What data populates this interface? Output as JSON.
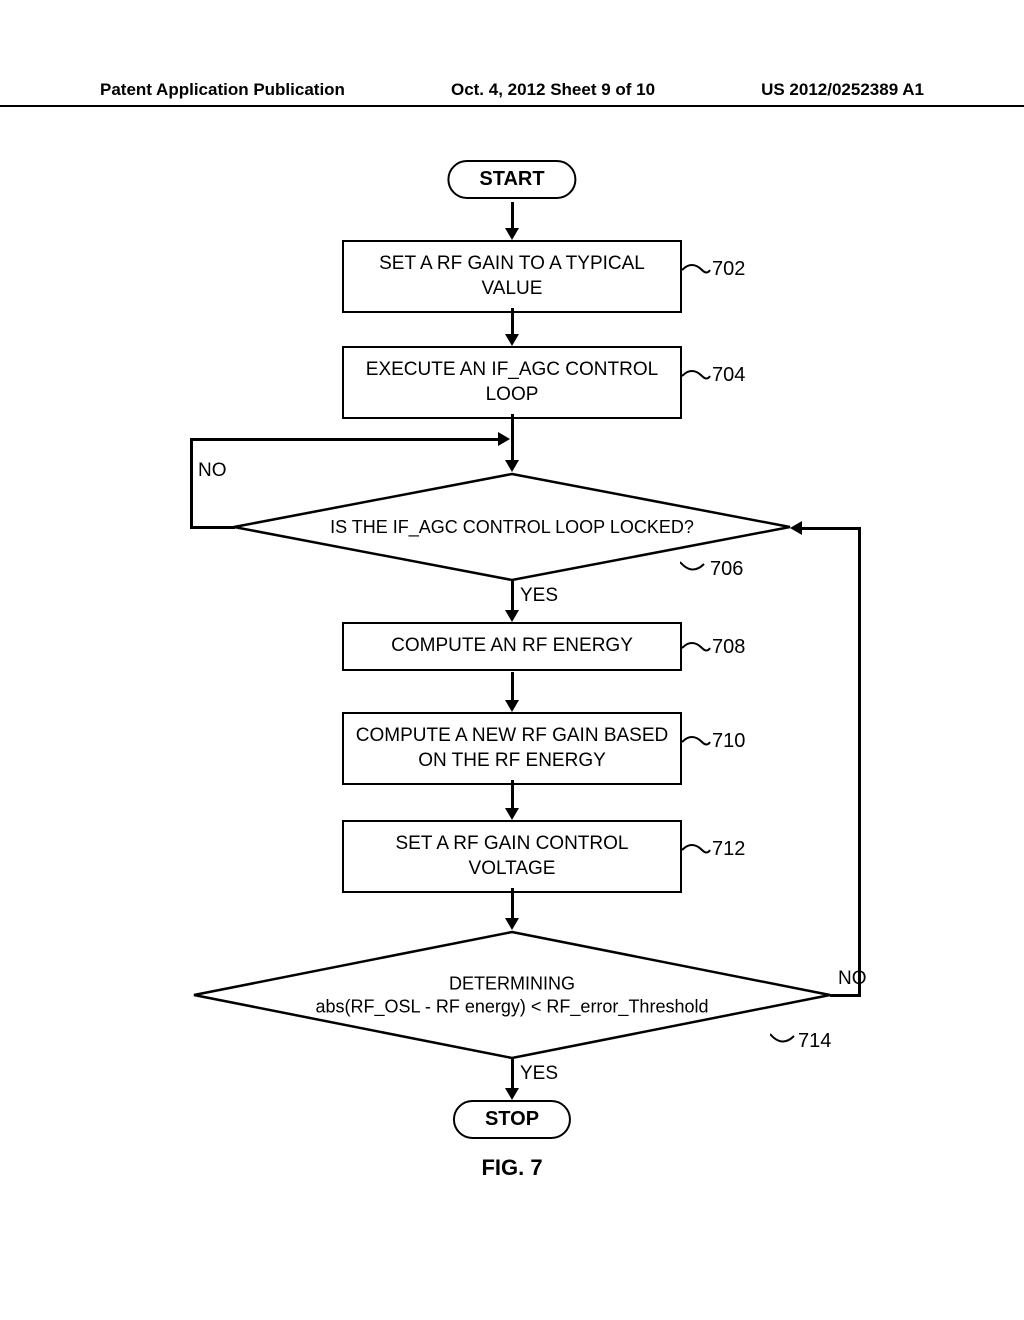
{
  "header": {
    "left": "Patent Application Publication",
    "center": "Oct. 4, 2012  Sheet 9 of 10",
    "right": "US 2012/0252389 A1"
  },
  "chart_data": {
    "type": "flowchart",
    "title": "FIG. 7",
    "nodes": [
      {
        "id": "start",
        "type": "terminal",
        "text": "START"
      },
      {
        "id": "702",
        "type": "process",
        "text": "SET A RF GAIN TO A TYPICAL VALUE",
        "ref": "702"
      },
      {
        "id": "704",
        "type": "process",
        "text": "EXECUTE AN IF_AGC CONTROL LOOP",
        "ref": "704"
      },
      {
        "id": "706",
        "type": "decision",
        "text": "IS THE IF_AGC CONTROL LOOP LOCKED?",
        "ref": "706"
      },
      {
        "id": "708",
        "type": "process",
        "text": "COMPUTE AN RF ENERGY",
        "ref": "708"
      },
      {
        "id": "710",
        "type": "process",
        "text": "COMPUTE A NEW RF GAIN BASED ON THE RF ENERGY",
        "ref": "710"
      },
      {
        "id": "712",
        "type": "process",
        "text": "SET A RF GAIN CONTROL VOLTAGE",
        "ref": "712"
      },
      {
        "id": "714",
        "type": "decision",
        "text": "DETERMINING\nabs(RF_OSL - RF energy) < RF_error_Threshold",
        "ref": "714"
      },
      {
        "id": "stop",
        "type": "terminal",
        "text": "STOP"
      }
    ],
    "edges": [
      {
        "from": "start",
        "to": "702"
      },
      {
        "from": "702",
        "to": "704"
      },
      {
        "from": "704",
        "to": "706"
      },
      {
        "from": "706",
        "to": "708",
        "label": "YES"
      },
      {
        "from": "706",
        "to": "706",
        "label": "NO"
      },
      {
        "from": "708",
        "to": "710"
      },
      {
        "from": "710",
        "to": "712"
      },
      {
        "from": "712",
        "to": "714"
      },
      {
        "from": "714",
        "to": "stop",
        "label": "YES"
      },
      {
        "from": "714",
        "to": "706",
        "label": "NO"
      }
    ]
  },
  "labels": {
    "start": "START",
    "stop": "STOP",
    "yes1": "YES",
    "no1": "NO",
    "yes2": "YES",
    "no2": "NO",
    "ref702": "702",
    "ref704": "704",
    "ref706": "706",
    "ref708": "708",
    "ref710": "710",
    "ref712": "712",
    "ref714": "714",
    "box702": "SET A RF GAIN TO A TYPICAL VALUE",
    "box704": "EXECUTE AN IF_AGC CONTROL LOOP",
    "dec706": "IS THE IF_AGC CONTROL LOOP LOCKED?",
    "box708": "COMPUTE AN RF ENERGY",
    "box710": "COMPUTE A NEW RF GAIN BASED ON THE RF ENERGY",
    "box712": "SET A RF GAIN CONTROL VOLTAGE",
    "dec714a": "DETERMINING",
    "dec714b": "abs(RF_OSL - RF energy) < RF_error_Threshold",
    "figcap": "FIG. 7"
  }
}
